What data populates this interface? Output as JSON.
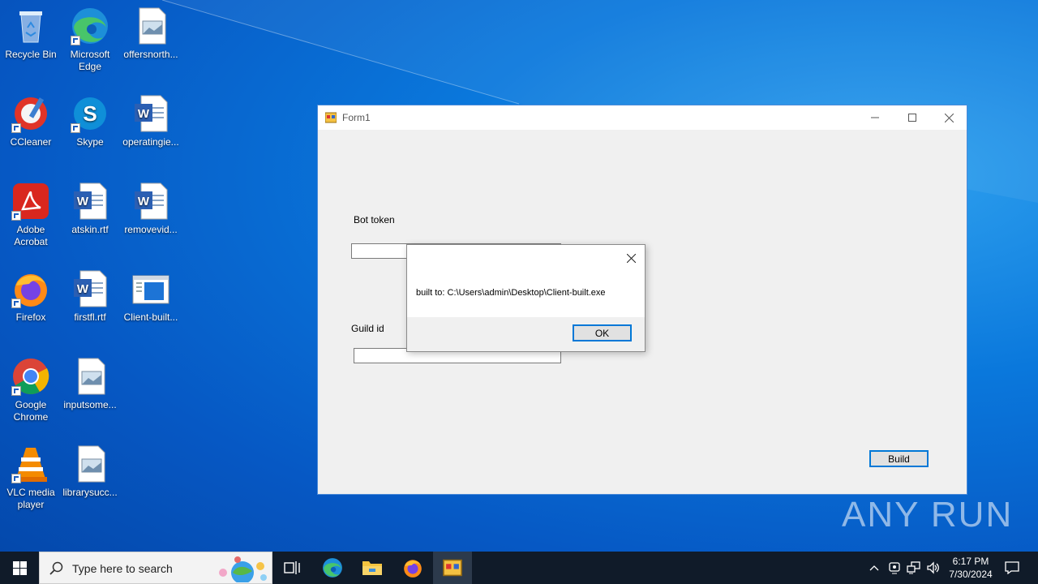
{
  "desktop": {
    "icons": [
      {
        "label": "Recycle Bin"
      },
      {
        "label": "Microsoft Edge"
      },
      {
        "label": "offersnorth..."
      },
      {
        "label": "CCleaner"
      },
      {
        "label": "Skype"
      },
      {
        "label": "operatingie..."
      },
      {
        "label": "Adobe Acrobat"
      },
      {
        "label": "atskin.rtf"
      },
      {
        "label": "removevid..."
      },
      {
        "label": "Firefox"
      },
      {
        "label": "firstfl.rtf"
      },
      {
        "label": "Client-built..."
      },
      {
        "label": "Google Chrome"
      },
      {
        "label": "inputsome..."
      },
      {
        "label": "VLC media player"
      },
      {
        "label": "librarysucc..."
      }
    ]
  },
  "form": {
    "title": "Form1",
    "bot_token_label": "Bot token",
    "bot_token_value": "",
    "guild_id_label": "Guild id",
    "guild_id_value": "",
    "build_label": "Build"
  },
  "message_box": {
    "text": "built to: C:\\Users\\admin\\Desktop\\Client-built.exe",
    "ok_label": "OK"
  },
  "watermark": {
    "text": "ANY RUN"
  },
  "taskbar": {
    "search_placeholder": "Type here to search",
    "time": "6:17 PM",
    "date": "7/30/2024"
  },
  "colors": {
    "accent": "#0078d7",
    "taskbar": "#101b29"
  }
}
